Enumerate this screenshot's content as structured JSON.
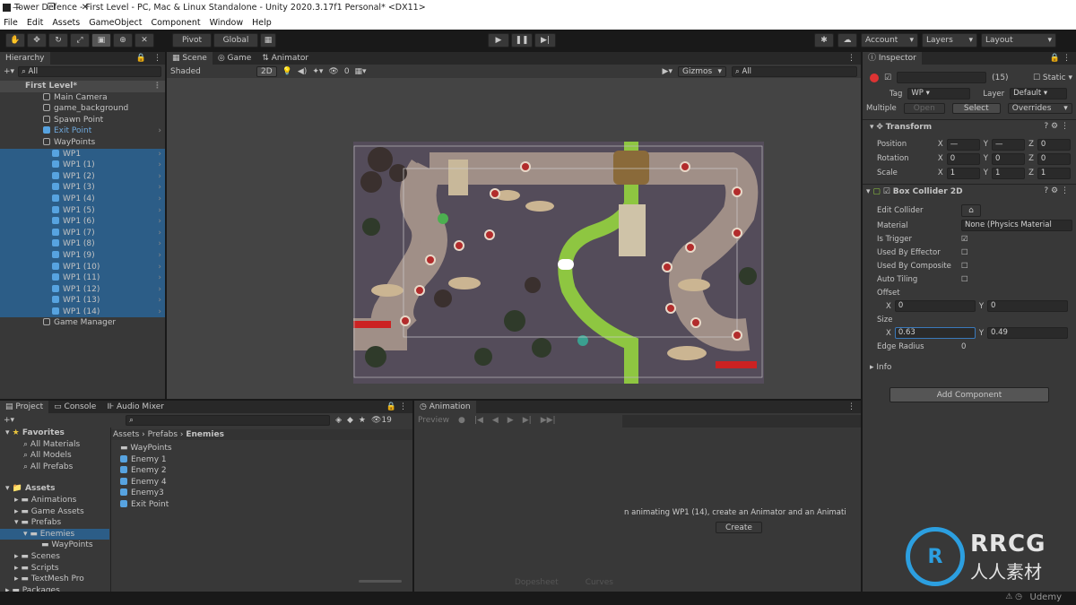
{
  "window": {
    "title": "Tower Defence - First Level - PC, Mac & Linux Standalone - Unity 2020.3.17f1 Personal* <DX11>",
    "min": "—",
    "max": "❐",
    "close": "✕"
  },
  "menu": [
    "File",
    "Edit",
    "Assets",
    "GameObject",
    "Component",
    "Window",
    "Help"
  ],
  "toolbar": {
    "pivot": "Pivot",
    "global": "Global",
    "account": "Account",
    "layers": "Layers",
    "layout": "Layout"
  },
  "hierarchy": {
    "tab": "Hierarchy",
    "search": "All",
    "scene": "First Level*",
    "items": [
      "Main Camera",
      "game_background",
      "Spawn Point",
      "Exit Point",
      "WayPoints"
    ],
    "waypoints": [
      "WP1",
      "WP1 (1)",
      "WP1 (2)",
      "WP1 (3)",
      "WP1 (4)",
      "WP1 (5)",
      "WP1 (6)",
      "WP1 (7)",
      "WP1 (8)",
      "WP1 (9)",
      "WP1 (10)",
      "WP1 (11)",
      "WP1 (12)",
      "WP1 (13)",
      "WP1 (14)"
    ],
    "last": "Game Manager"
  },
  "scene": {
    "tabs": [
      "Scene",
      "Game",
      "Animator"
    ],
    "shading": "Shaded",
    "mode2d": "2D",
    "gizmos": "Gizmos",
    "search": "All",
    "layers_count": "0"
  },
  "project": {
    "tabs": [
      "Project",
      "Console",
      "Audio Mixer"
    ],
    "favorites": "Favorites",
    "fav_items": [
      "All Materials",
      "All Models",
      "All Prefabs"
    ],
    "assets": "Assets",
    "folders": [
      "Animations",
      "Game Assets",
      "Prefabs",
      "Enemies",
      "WayPoints",
      "Scenes",
      "Scripts",
      "TextMesh Pro",
      "Packages"
    ],
    "breadcrumb": [
      "Assets",
      "Prefabs",
      "Enemies"
    ],
    "files": [
      "WayPoints",
      "Enemy 1",
      "Enemy 2",
      "Enemy 4",
      "Enemy3",
      "Exit Point"
    ],
    "count": "19"
  },
  "animation": {
    "tab": "Animation",
    "preview": "Preview",
    "msg": "n animating WP1 (14), create an Animator and an Animati",
    "create": "Create",
    "dopesheet": "Dopesheet",
    "curves": "Curves"
  },
  "inspector": {
    "tab": "Inspector",
    "count": "(15)",
    "static": "Static",
    "tag_label": "Tag",
    "tag": "WP",
    "layer_label": "Layer",
    "layer": "Default",
    "multiple": "Multiple",
    "open": "Open",
    "select": "Select",
    "overrides": "Overrides",
    "transform": "Transform",
    "position": "Position",
    "rotation": "Rotation",
    "scale": "Scale",
    "pos": [
      "—",
      "—",
      "0"
    ],
    "rot": [
      "0",
      "0",
      "0"
    ],
    "scl": [
      "1",
      "1",
      "1"
    ],
    "collider": "Box Collider 2D",
    "edit_collider": "Edit Collider",
    "material": "Material",
    "material_val": "None (Physics Material",
    "is_trigger": "Is Trigger",
    "used_effector": "Used By Effector",
    "used_composite": "Used By Composite",
    "auto_tiling": "Auto Tiling",
    "offset": "Offset",
    "offset_x": "0",
    "offset_y": "0",
    "size": "Size",
    "size_x": "0.63",
    "size_y": "0.49",
    "edge_radius": "Edge Radius",
    "edge_val": "0",
    "info": "Info",
    "add_component": "Add Component"
  },
  "watermark": {
    "brand": "RRCG",
    "cn": "人人素材",
    "udemy": "Udemy"
  }
}
